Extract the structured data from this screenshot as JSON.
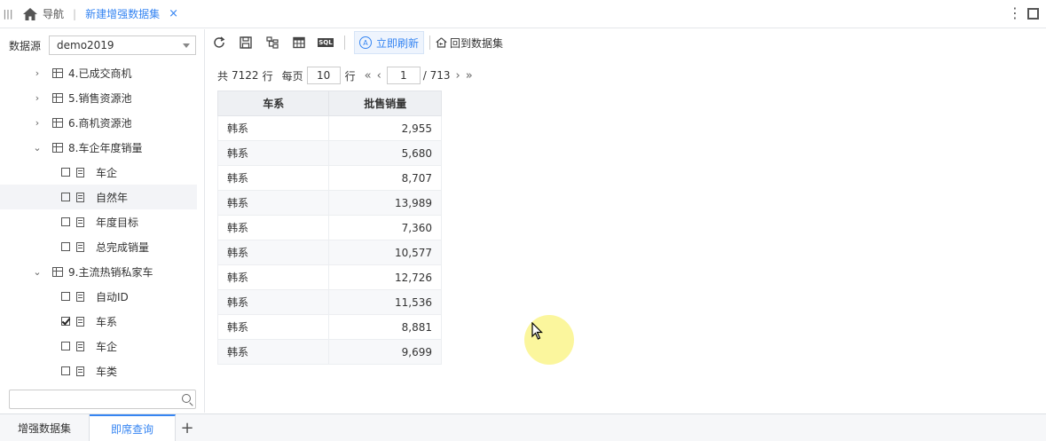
{
  "topbar": {
    "nav_label": "导航",
    "active_tab": "新建增强数据集",
    "close_glyph": "×"
  },
  "datasource": {
    "label": "数据源",
    "value": "demo2019"
  },
  "tree": [
    {
      "kind": "table",
      "label": "4.已成交商机",
      "expanded": false
    },
    {
      "kind": "table",
      "label": "5.销售资源池",
      "expanded": false
    },
    {
      "kind": "table",
      "label": "6.商机资源池",
      "expanded": false
    },
    {
      "kind": "table",
      "label": "8.车企年度销量",
      "expanded": true
    },
    {
      "kind": "field",
      "label": "车企",
      "checked": false
    },
    {
      "kind": "field",
      "label": "自然年",
      "checked": false,
      "selected": true
    },
    {
      "kind": "field",
      "label": "年度目标",
      "checked": false
    },
    {
      "kind": "field",
      "label": "总完成销量",
      "checked": false
    },
    {
      "kind": "table",
      "label": "9.主流热销私家车",
      "expanded": true
    },
    {
      "kind": "field",
      "label": "自动ID",
      "checked": false
    },
    {
      "kind": "field",
      "label": "车系",
      "checked": true
    },
    {
      "kind": "field",
      "label": "车企",
      "checked": false
    },
    {
      "kind": "field",
      "label": "车类",
      "checked": false
    }
  ],
  "search": {
    "placeholder": "",
    "value": ""
  },
  "toolbar": {
    "refresh_now_label": "立即刷新",
    "back_label": "回到数据集",
    "sql_label": "SQL"
  },
  "pager": {
    "total_prefix": "共",
    "total_rows": "7122",
    "row_unit": "行",
    "per_page_label": "每页",
    "per_page": "10",
    "per_page_unit": "行",
    "current_page": "1",
    "total_pages": "/ 713"
  },
  "table": {
    "columns": [
      "车系",
      "批售销量"
    ],
    "rows": [
      [
        "韩系",
        "2,955"
      ],
      [
        "韩系",
        "5,680"
      ],
      [
        "韩系",
        "8,707"
      ],
      [
        "韩系",
        "13,989"
      ],
      [
        "韩系",
        "7,360"
      ],
      [
        "韩系",
        "10,577"
      ],
      [
        "韩系",
        "12,726"
      ],
      [
        "韩系",
        "11,536"
      ],
      [
        "韩系",
        "8,881"
      ],
      [
        "韩系",
        "9,699"
      ]
    ]
  },
  "bottom_tabs": [
    {
      "label": "增强数据集",
      "active": false
    },
    {
      "label": "即席查询",
      "active": true
    }
  ],
  "bottom_add": "+"
}
